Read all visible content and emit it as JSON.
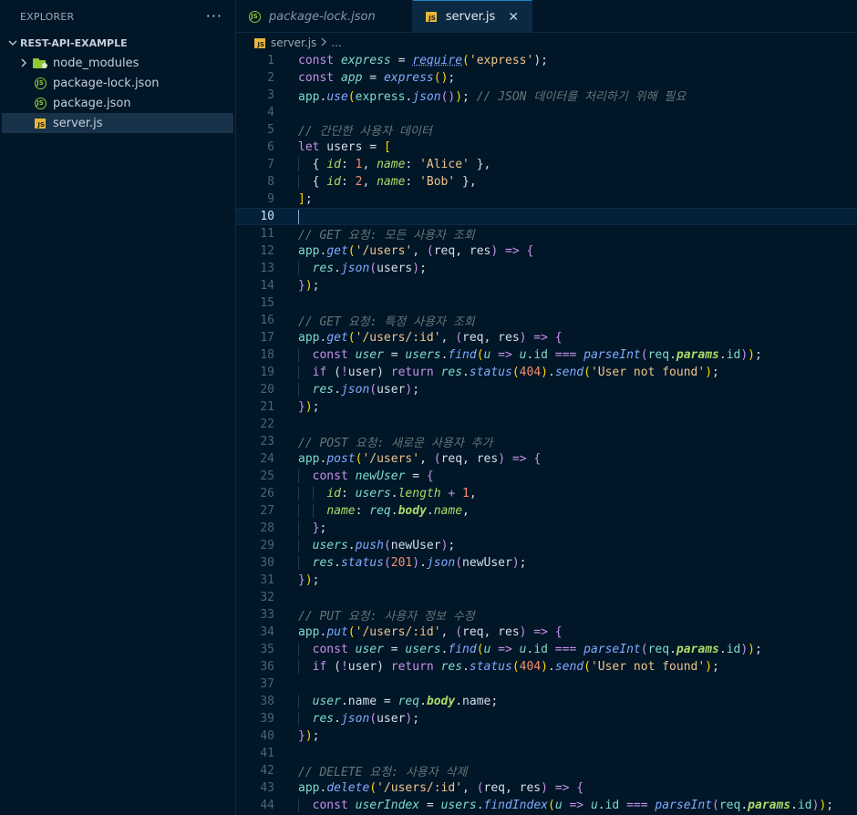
{
  "sidebar": {
    "title": "EXPLORER",
    "more": "···",
    "root": "REST-API-EXAMPLE",
    "items": [
      {
        "label": "node_modules"
      },
      {
        "label": "package-lock.json"
      },
      {
        "label": "package.json"
      },
      {
        "label": "server.js"
      }
    ]
  },
  "tabs": [
    {
      "label": "package-lock.json"
    },
    {
      "label": "server.js"
    }
  ],
  "icons": {
    "js": "JS",
    "json": "{}",
    "close": "✕",
    "chevron_right": "›",
    "chevron_down": "⌄"
  },
  "breadcrumb": {
    "file": "server.js",
    "sep": ">",
    "rest": "..."
  },
  "editor": {
    "current_line": 10,
    "lines": [
      {
        "n": "1"
      },
      {
        "n": "2"
      },
      {
        "n": "3"
      },
      {
        "n": "4"
      },
      {
        "n": "5"
      },
      {
        "n": "6"
      },
      {
        "n": "7"
      },
      {
        "n": "8"
      },
      {
        "n": "9"
      },
      {
        "n": "10"
      },
      {
        "n": "11"
      },
      {
        "n": "12"
      },
      {
        "n": "13"
      },
      {
        "n": "14"
      },
      {
        "n": "15"
      },
      {
        "n": "16"
      },
      {
        "n": "17"
      },
      {
        "n": "18"
      },
      {
        "n": "19"
      },
      {
        "n": "20"
      },
      {
        "n": "21"
      },
      {
        "n": "22"
      },
      {
        "n": "23"
      },
      {
        "n": "24"
      },
      {
        "n": "25"
      },
      {
        "n": "26"
      },
      {
        "n": "27"
      },
      {
        "n": "28"
      },
      {
        "n": "29"
      },
      {
        "n": "30"
      },
      {
        "n": "31"
      },
      {
        "n": "32"
      },
      {
        "n": "33"
      },
      {
        "n": "34"
      },
      {
        "n": "35"
      },
      {
        "n": "36"
      },
      {
        "n": "37"
      },
      {
        "n": "38"
      },
      {
        "n": "39"
      },
      {
        "n": "40"
      },
      {
        "n": "41"
      },
      {
        "n": "42"
      },
      {
        "n": "43"
      },
      {
        "n": "44"
      }
    ],
    "text": {
      "l1": [
        "const",
        " ",
        "express",
        " = ",
        "require",
        "(",
        "'express'",
        ");"
      ],
      "l2": [
        "const",
        " ",
        "app",
        " = ",
        "express",
        "(",
        ")",
        ";"
      ],
      "l3": [
        "app",
        ".",
        "use",
        "(",
        "express",
        ".",
        "json",
        "(",
        ")",
        ")",
        "; ",
        "// JSON 데이터를 처리하기 위해 필요"
      ],
      "l5": "// 간단한 사용자 데이터",
      "l6": [
        "let",
        " users = ",
        "["
      ],
      "l7": [
        "{ ",
        "id",
        ": ",
        "1",
        ", ",
        "name",
        ": ",
        "'Alice'",
        " },"
      ],
      "l8": [
        "{ ",
        "id",
        ": ",
        "2",
        ", ",
        "name",
        ": ",
        "'Bob'",
        " },"
      ],
      "l9": [
        "]",
        ";"
      ],
      "l11": "// GET 요청: 모든 사용자 조회",
      "l12": [
        "app",
        ".",
        "get",
        "(",
        "'/users'",
        ", ",
        "(",
        "req, res",
        ")",
        " => ",
        "{"
      ],
      "l13": [
        "res",
        ".",
        "json",
        "(",
        "users",
        ")",
        ";"
      ],
      "l14": [
        "}",
        ")",
        ";"
      ],
      "l16": "// GET 요청: 특정 사용자 조회",
      "l17": [
        "app",
        ".",
        "get",
        "(",
        "'/users/:id'",
        ", ",
        "(",
        "req, res",
        ")",
        " => ",
        "{"
      ],
      "l18": [
        "const",
        " ",
        "user",
        " = ",
        "users",
        ".",
        "find",
        "(",
        "u",
        " => ",
        "u",
        ".",
        "id",
        " === ",
        "parseInt",
        "(",
        "req",
        ".",
        "params",
        ".",
        "id",
        ")",
        ")",
        ";"
      ],
      "l19": [
        "if",
        " (",
        "!",
        "user) ",
        "return",
        " ",
        "res",
        ".",
        "status",
        "(",
        "404",
        ")",
        ".",
        "send",
        "(",
        "'User not found'",
        ")",
        ";"
      ],
      "l20": [
        "res",
        ".",
        "json",
        "(",
        "user",
        ")",
        ";"
      ],
      "l21": [
        "}",
        ")",
        ";"
      ],
      "l23": "// POST 요청: 새로운 사용자 추가",
      "l24": [
        "app",
        ".",
        "post",
        "(",
        "'/users'",
        ", ",
        "(",
        "req, res",
        ")",
        " => ",
        "{"
      ],
      "l25": [
        "const",
        " ",
        "newUser",
        " = ",
        "{"
      ],
      "l26": [
        "id",
        ": ",
        "users",
        ".",
        "length",
        " + ",
        "1",
        ","
      ],
      "l27": [
        "name",
        ": ",
        "req",
        ".",
        "body",
        ".",
        "name",
        ","
      ],
      "l28": [
        "}",
        ";"
      ],
      "l29": [
        "users",
        ".",
        "push",
        "(",
        "newUser",
        ")",
        ";"
      ],
      "l30": [
        "res",
        ".",
        "status",
        "(",
        "201",
        ")",
        ".",
        "json",
        "(",
        "newUser",
        ")",
        ";"
      ],
      "l31": [
        "}",
        ")",
        ";"
      ],
      "l33": "// PUT 요청: 사용자 정보 수정",
      "l34": [
        "app",
        ".",
        "put",
        "(",
        "'/users/:id'",
        ", ",
        "(",
        "req, res",
        ")",
        " => ",
        "{"
      ],
      "l35": [
        "const",
        " ",
        "user",
        " = ",
        "users",
        ".",
        "find",
        "(",
        "u",
        " => ",
        "u",
        ".",
        "id",
        " === ",
        "parseInt",
        "(",
        "req",
        ".",
        "params",
        ".",
        "id",
        ")",
        ")",
        ";"
      ],
      "l36": [
        "if",
        " (",
        "!",
        "user) ",
        "return",
        " ",
        "res",
        ".",
        "status",
        "(",
        "404",
        ")",
        ".",
        "send",
        "(",
        "'User not found'",
        ")",
        ";"
      ],
      "l38": [
        "user",
        ".name = ",
        "req",
        ".",
        "body",
        ".",
        "name",
        ";"
      ],
      "l39": [
        "res",
        ".",
        "json",
        "(",
        "user",
        ")",
        ";"
      ],
      "l40": [
        "}",
        ")",
        ";"
      ],
      "l42": "// DELETE 요청: 사용자 삭제",
      "l43": [
        "app",
        ".",
        "delete",
        "(",
        "'/users/:id'",
        ", ",
        "(",
        "req, res",
        ")",
        " => ",
        "{"
      ],
      "l44": [
        "const",
        " ",
        "userIndex",
        " = ",
        "users",
        ".",
        "findIndex",
        "(",
        "u",
        " => ",
        "u",
        ".",
        "id",
        " === ",
        "parseInt",
        "(",
        "req",
        ".",
        "params",
        ".",
        "id",
        ")",
        ")",
        ";"
      ]
    }
  },
  "colors": {
    "background": "#011627",
    "keyword": "#c792ea",
    "variable": "#7fdbca",
    "function": "#82aaff",
    "string": "#ecc48d",
    "number": "#f78c6c",
    "comment": "#637777",
    "property": "#addb67",
    "tab_accent": "#2188c6"
  }
}
